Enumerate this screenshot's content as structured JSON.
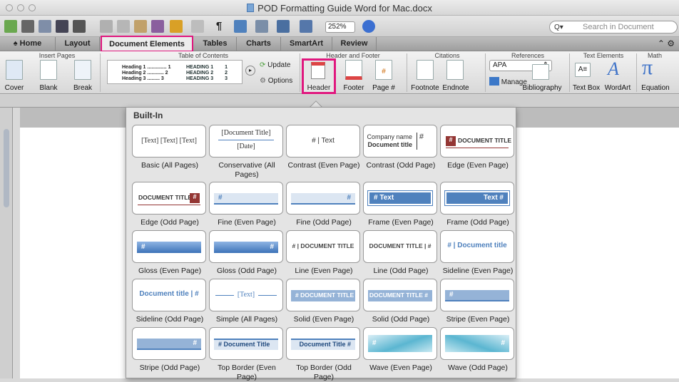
{
  "window": {
    "title": "POD Formatting Guide Word for Mac.docx"
  },
  "toolbar": {
    "zoom": "252%",
    "search_placeholder": "Search in Document"
  },
  "ribbon_tabs": [
    {
      "label": "Home",
      "active": false
    },
    {
      "label": "Layout",
      "active": false
    },
    {
      "label": "Document Elements",
      "active": true
    },
    {
      "label": "Tables",
      "active": false
    },
    {
      "label": "Charts",
      "active": false
    },
    {
      "label": "SmartArt",
      "active": false
    },
    {
      "label": "Review",
      "active": false
    }
  ],
  "ribbon": {
    "groups": {
      "insert_pages": "Insert Pages",
      "toc": "Table of Contents",
      "header_footer": "Header and Footer",
      "citations": "Citations",
      "references": "References",
      "text_elements": "Text Elements",
      "math": "Math"
    },
    "buttons": {
      "cover": "Cover",
      "blank": "Blank",
      "break": "Break",
      "update": "Update",
      "options": "Options",
      "header": "Header",
      "footer": "Footer",
      "page_num": "Page #",
      "footnote": "Footnote",
      "endnote": "Endnote",
      "style": "APA",
      "manage": "Manage",
      "bibliography": "Bibliography",
      "text_box": "Text Box",
      "wordart": "WordArt",
      "equation": "Equation"
    },
    "toc_preview": {
      "col1": [
        "Heading 1 .............. 1",
        "Heading 2 ............ 2",
        "Heading 3 ......... 3"
      ],
      "col2": [
        "HEADING 1",
        "HEADING 2",
        "HEADING 3"
      ],
      "col2_nums": [
        "1",
        "2",
        "3"
      ]
    }
  },
  "gallery": {
    "title": "Built-In",
    "items": [
      {
        "label": "Basic (All Pages)",
        "preview": "[Text]   [Text]   [Text]"
      },
      {
        "label": "Conservative (All Pages)",
        "preview": "[Document Title]",
        "preview2": "[Date]"
      },
      {
        "label": "Contrast (Even Page)",
        "preview": "# | Text"
      },
      {
        "label": "Contrast (Odd Page)",
        "preview": "Company name",
        "preview2": "Document title"
      },
      {
        "label": "Edge (Even Page)",
        "preview": "DOCUMENT TITLE"
      },
      {
        "label": "Edge (Odd Page)",
        "preview": "DOCUMENT TITLE"
      },
      {
        "label": "Fine (Even Page)",
        "preview": "#"
      },
      {
        "label": "Fine (Odd Page)",
        "preview": "#"
      },
      {
        "label": "Frame (Even Page)",
        "preview": "# Text"
      },
      {
        "label": "Frame (Odd Page)",
        "preview": "Text #"
      },
      {
        "label": "Gloss (Even Page)",
        "preview": "#"
      },
      {
        "label": "Gloss (Odd Page)",
        "preview": "#"
      },
      {
        "label": "Line (Even Page)",
        "preview": "#  |  DOCUMENT TITLE"
      },
      {
        "label": "Line (Odd Page)",
        "preview": "DOCUMENT TITLE  |  #"
      },
      {
        "label": "Sideline (Even Page)",
        "preview": "#  |  Document title"
      },
      {
        "label": "Sideline (Odd Page)",
        "preview": "Document title  |  #"
      },
      {
        "label": "Simple (All Pages)",
        "preview": "[Text]"
      },
      {
        "label": "Solid (Even Page)",
        "preview": "# DOCUMENT TITLE"
      },
      {
        "label": "Solid (Odd Page)",
        "preview": "DOCUMENT TITLE #"
      },
      {
        "label": "Stripe (Even Page)",
        "preview": "#"
      },
      {
        "label": "Stripe (Odd Page)",
        "preview": "#"
      },
      {
        "label": "Top Border (Even Page)",
        "preview": "# Document Title"
      },
      {
        "label": "Top Border (Odd Page)",
        "preview": "Document Title #"
      },
      {
        "label": "Wave (Even Page)",
        "preview": "#"
      },
      {
        "label": "Wave (Odd Page)",
        "preview": "#"
      }
    ]
  },
  "colors": {
    "highlight": "#e0177e",
    "accent_blue": "#4f81bd",
    "edge_red": "#943634"
  }
}
